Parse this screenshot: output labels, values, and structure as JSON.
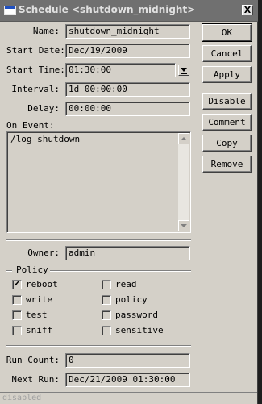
{
  "window": {
    "title": "Schedule <shutdown_midnight>",
    "close_glyph": "X",
    "icon": "window-icon"
  },
  "form": {
    "name_label": "Name:",
    "name_value": "shutdown_midnight",
    "start_date_label": "Start Date:",
    "start_date_value": "Dec/19/2009",
    "start_time_label": "Start Time:",
    "start_time_value": "01:30:00",
    "interval_label": "Interval:",
    "interval_value": "1d 00:00:00",
    "delay_label": "Delay:",
    "delay_value": "00:00:00",
    "on_event_label": "On Event:",
    "on_event_value": "/log shutdown",
    "owner_label": "Owner:",
    "owner_value": "admin",
    "run_count_label": "Run Count:",
    "run_count_value": "0",
    "next_run_label": "Next Run:",
    "next_run_value": "Dec/21/2009 01:30:00"
  },
  "buttons": {
    "ok": "OK",
    "cancel": "Cancel",
    "apply": "Apply",
    "disable": "Disable",
    "comment": "Comment",
    "copy": "Copy",
    "remove": "Remove"
  },
  "policy": {
    "title": "Policy",
    "items": [
      {
        "label": "reboot",
        "checked": true,
        "mark": "✔"
      },
      {
        "label": "read",
        "checked": false,
        "mark": ""
      },
      {
        "label": "write",
        "checked": false,
        "mark": ""
      },
      {
        "label": "policy",
        "checked": false,
        "mark": ""
      },
      {
        "label": "test",
        "checked": false,
        "mark": ""
      },
      {
        "label": "password",
        "checked": false,
        "mark": ""
      },
      {
        "label": "sniff",
        "checked": false,
        "mark": ""
      },
      {
        "label": "sensitive",
        "checked": false,
        "mark": ""
      }
    ]
  },
  "status": {
    "text": "disabled"
  }
}
